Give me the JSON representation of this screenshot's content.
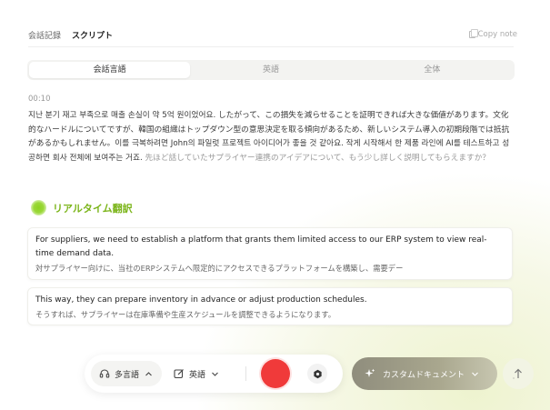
{
  "top_tabs": [
    {
      "label": "会話記録"
    },
    {
      "label": "スクリプト"
    }
  ],
  "copy_note": "Copy note",
  "segments": [
    {
      "label": "会話言語"
    },
    {
      "label": "英語"
    },
    {
      "label": "全体"
    }
  ],
  "timestamp": "00:10",
  "transcript": {
    "main": "지난 분기 재고 부족으로 매출 손실이 약 5억 원이었어요. したがって、この損失を減らせることを証明できれば大きな価値があります。文化的なハードルについてですが、韓国の組織はトップダウン型の意思決定を取る傾向があるため、新しいシステム導入の初期段階では抵抗があるかもしれません。이를 극복하려면 John의 파일럿 프로젝트 아이디어가 좋을 것 같아요. 작게 시작해서 한 제품 라인에 AI를 테스트하고 성공하면 회사 전체에 보여주는 거죠.",
    "faded": " 先ほど話していたサプライヤー連携のアイデアについて、もう少し詳しく説明してもらえますか？"
  },
  "realtime": {
    "heading": "リアルタイム翻訳",
    "accent": "#7ab418"
  },
  "translations": [
    {
      "en": "For suppliers, we need to establish a platform that grants them limited access to our ERP system to view real-time demand data.",
      "ja": "対サプライヤー向けに、当社のERPシステムへ限定的にアクセスできるプラットフォームを構築し、需要デー"
    },
    {
      "en": "This way, they can prepare inventory in advance or adjust production schedules.",
      "ja": "そうすれば、サプライヤーは在庫準備や生産スケジュールを調整できるようになります。"
    }
  ],
  "toolbar": {
    "lang_mode": "多言語",
    "target_lang": "英語",
    "record_color": "#f03a3a"
  },
  "custom_doc": "カスタムドキュメント",
  "icons": {
    "headset": "headset-icon",
    "edit": "edit-icon",
    "settings": "gear-icon",
    "sparkle": "sparkle-icon",
    "upload": "upload-icon"
  }
}
